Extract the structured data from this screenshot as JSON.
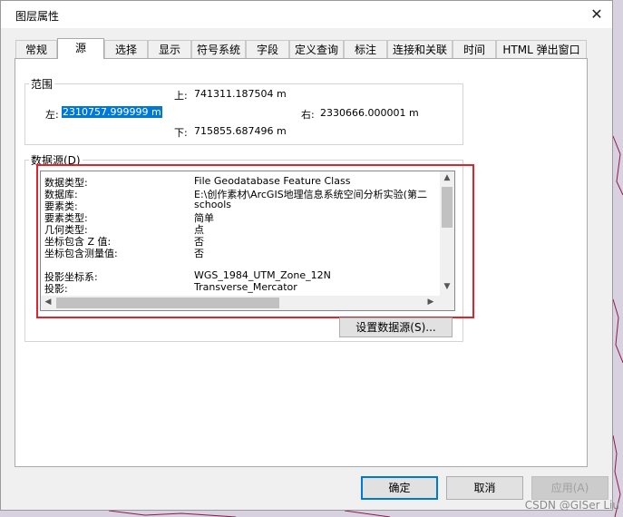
{
  "dialog": {
    "title": "图层属性",
    "tabs": [
      {
        "label": "常规",
        "active": false
      },
      {
        "label": "源",
        "active": true
      },
      {
        "label": "选择",
        "active": false
      },
      {
        "label": "显示",
        "active": false
      },
      {
        "label": "符号系统",
        "active": false
      },
      {
        "label": "字段",
        "active": false
      },
      {
        "label": "定义查询",
        "active": false
      },
      {
        "label": "标注",
        "active": false
      },
      {
        "label": "连接和关联",
        "active": false
      },
      {
        "label": "时间",
        "active": false
      },
      {
        "label": "HTML 弹出窗口",
        "active": false
      }
    ]
  },
  "extent": {
    "label": "范围",
    "top_label": "上:",
    "top_value": "741311.187504 m",
    "left_label": "左:",
    "left_value": "2310757.999999 m",
    "right_label": "右:",
    "right_value": "2330666.000001 m",
    "bottom_label": "下:",
    "bottom_value": "715855.687496 m"
  },
  "datasource": {
    "label": "数据源(D)",
    "rows": [
      {
        "key": "数据类型:",
        "value": "File Geodatabase Feature Class"
      },
      {
        "key": "数据库:",
        "value": "E:\\创作素材\\ArcGIS地理信息系统空间分析实验(第二"
      },
      {
        "key": "要素类:",
        "value": "schools"
      },
      {
        "key": "要素类型:",
        "value": "简单"
      },
      {
        "key": "几何类型:",
        "value": "点"
      },
      {
        "key": "坐标包含 Z 值:",
        "value": "否"
      },
      {
        "key": "坐标包含测量值:",
        "value": "否"
      },
      {
        "key": "",
        "value": ""
      },
      {
        "key": "投影坐标系:",
        "value": "WGS_1984_UTM_Zone_12N"
      },
      {
        "key": "投影:",
        "value": "Transverse_Mercator"
      }
    ],
    "set_button": "设置数据源(S)..."
  },
  "buttons": {
    "ok": "确定",
    "cancel": "取消",
    "apply": "应用(A)"
  },
  "watermark": "CSDN @GISer Liu",
  "colors": {
    "selection": "#0078d7",
    "highlight_box": "#e0242b",
    "map_background": "#d8d2e0",
    "map_lines": "#8b1a4a"
  }
}
